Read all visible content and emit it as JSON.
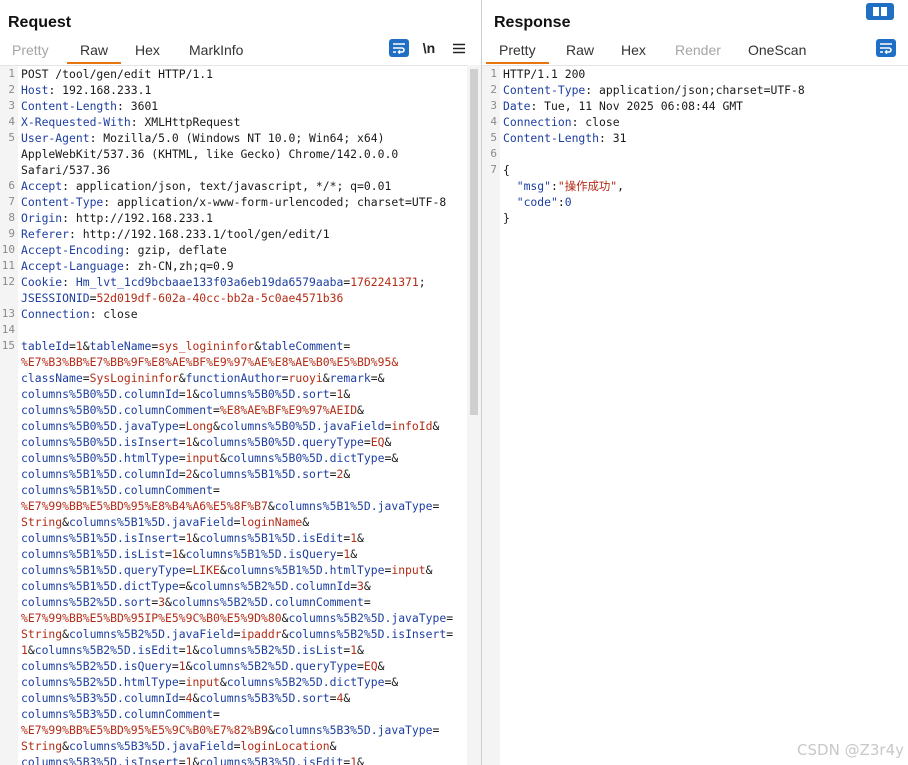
{
  "request": {
    "title": "Request",
    "tabs": [
      "Pretty",
      "Raw",
      "Hex",
      "MarkInfo"
    ],
    "active_tab": "Raw",
    "newline_label": "\\n",
    "lines": [
      {
        "n": "1",
        "type": "first",
        "text": "POST /tool/gen/edit HTTP/1.1"
      },
      {
        "n": "2",
        "type": "header",
        "key": "Host",
        "value": "192.168.233.1"
      },
      {
        "n": "3",
        "type": "header",
        "key": "Content-Length",
        "value": "3601"
      },
      {
        "n": "4",
        "type": "header",
        "key": "X-Requested-With",
        "value": "XMLHttpRequest"
      },
      {
        "n": "5",
        "type": "header",
        "key": "User-Agent",
        "value": "Mozilla/5.0 (Windows NT 10.0; Win64; x64)"
      },
      {
        "n": "",
        "type": "plain",
        "text": "AppleWebKit/537.36 (KHTML, like Gecko) Chrome/142.0.0.0"
      },
      {
        "n": "",
        "type": "plain",
        "text": "Safari/537.36"
      },
      {
        "n": "6",
        "type": "header",
        "key": "Accept",
        "value": "application/json, text/javascript, */*; q=0.01"
      },
      {
        "n": "7",
        "type": "header",
        "key": "Content-Type",
        "value": "application/x-www-form-urlencoded; charset=UTF-8"
      },
      {
        "n": "8",
        "type": "header",
        "key": "Origin",
        "value": "http://192.168.233.1"
      },
      {
        "n": "9",
        "type": "header",
        "key": "Referer",
        "value": "http://192.168.233.1/tool/gen/edit/1"
      },
      {
        "n": "10",
        "type": "header",
        "key": "Accept-Encoding",
        "value": "gzip, deflate"
      },
      {
        "n": "11",
        "type": "header",
        "key": "Accept-Language",
        "value": "zh-CN,zh;q=0.9"
      },
      {
        "n": "12",
        "type": "cookie",
        "key": "Cookie",
        "k1": "Hm_lvt_1cd9bcbaae133f03a6eb19da6579aaba",
        "v1": "1762241371"
      },
      {
        "n": "",
        "type": "cookie2",
        "k2": "JSESSIONID",
        "v2": "52d019df-602a-40cc-bb2a-5c0ae4571b36"
      },
      {
        "n": "13",
        "type": "header",
        "key": "Connection",
        "value": "close"
      },
      {
        "n": "14",
        "type": "plain",
        "text": ""
      },
      {
        "n": "15",
        "type": "body",
        "text": "tableId=1&tableName=sys_logininfor&tableComment="
      },
      {
        "n": "",
        "type": "body",
        "text": "%E7%B3%BB%E7%BB%9F%E8%AE%BF%E9%97%AE%E8%AE%B0%E5%BD%95&"
      },
      {
        "n": "",
        "type": "body",
        "text": "className=SysLogininfor&functionAuthor=ruoyi&remark=&"
      },
      {
        "n": "",
        "type": "body",
        "text": "columns%5B0%5D.columnId=1&columns%5B0%5D.sort=1&"
      },
      {
        "n": "",
        "type": "body",
        "text": "columns%5B0%5D.columnComment=%E8%AE%BF%E9%97%AEID&"
      },
      {
        "n": "",
        "type": "body",
        "text": "columns%5B0%5D.javaType=Long&columns%5B0%5D.javaField=infoId&"
      },
      {
        "n": "",
        "type": "body",
        "text": "columns%5B0%5D.isInsert=1&columns%5B0%5D.queryType=EQ&"
      },
      {
        "n": "",
        "type": "body",
        "text": "columns%5B0%5D.htmlType=input&columns%5B0%5D.dictType=&"
      },
      {
        "n": "",
        "type": "body",
        "text": "columns%5B1%5D.columnId=2&columns%5B1%5D.sort=2&"
      },
      {
        "n": "",
        "type": "body",
        "text": "columns%5B1%5D.columnComment="
      },
      {
        "n": "",
        "type": "body",
        "text": "%E7%99%BB%E5%BD%95%E8%B4%A6%E5%8F%B7&columns%5B1%5D.javaType="
      },
      {
        "n": "",
        "type": "body",
        "text": "String&columns%5B1%5D.javaField=loginName&"
      },
      {
        "n": "",
        "type": "body",
        "text": "columns%5B1%5D.isInsert=1&columns%5B1%5D.isEdit=1&"
      },
      {
        "n": "",
        "type": "body",
        "text": "columns%5B1%5D.isList=1&columns%5B1%5D.isQuery=1&"
      },
      {
        "n": "",
        "type": "body",
        "text": "columns%5B1%5D.queryType=LIKE&columns%5B1%5D.htmlType=input&"
      },
      {
        "n": "",
        "type": "body",
        "text": "columns%5B1%5D.dictType=&columns%5B2%5D.columnId=3&"
      },
      {
        "n": "",
        "type": "body",
        "text": "columns%5B2%5D.sort=3&columns%5B2%5D.columnComment="
      },
      {
        "n": "",
        "type": "body",
        "text": "%E7%99%BB%E5%BD%95IP%E5%9C%B0%E5%9D%80&columns%5B2%5D.javaType="
      },
      {
        "n": "",
        "type": "body",
        "text": "String&columns%5B2%5D.javaField=ipaddr&columns%5B2%5D.isInsert="
      },
      {
        "n": "",
        "type": "body",
        "text": "1&columns%5B2%5D.isEdit=1&columns%5B2%5D.isList=1&"
      },
      {
        "n": "",
        "type": "body",
        "text": "columns%5B2%5D.isQuery=1&columns%5B2%5D.queryType=EQ&"
      },
      {
        "n": "",
        "type": "body",
        "text": "columns%5B2%5D.htmlType=input&columns%5B2%5D.dictType=&"
      },
      {
        "n": "",
        "type": "body",
        "text": "columns%5B3%5D.columnId=4&columns%5B3%5D.sort=4&"
      },
      {
        "n": "",
        "type": "body",
        "text": "columns%5B3%5D.columnComment="
      },
      {
        "n": "",
        "type": "body",
        "text": "%E7%99%BB%E5%BD%95%E5%9C%B0%E7%82%B9&columns%5B3%5D.javaType="
      },
      {
        "n": "",
        "type": "body",
        "text": "String&columns%5B3%5D.javaField=loginLocation&"
      },
      {
        "n": "",
        "type": "body",
        "text": "columns%5B3%5D.isInsert=1&columns%5B3%5D.isEdit=1&"
      }
    ]
  },
  "response": {
    "title": "Response",
    "tabs": [
      "Pretty",
      "Raw",
      "Hex",
      "Render",
      "OneScan"
    ],
    "active_tab": "Pretty",
    "disabled_tabs": [
      "Render"
    ],
    "lines": [
      {
        "n": "1",
        "type": "first",
        "text": "HTTP/1.1 200"
      },
      {
        "n": "2",
        "type": "header",
        "key": "Content-Type",
        "value": "application/json;charset=UTF-8"
      },
      {
        "n": "3",
        "type": "header",
        "key": "Date",
        "value": "Tue, 11 Nov 2025 06:08:44 GMT"
      },
      {
        "n": "4",
        "type": "header",
        "key": "Connection",
        "value": "close"
      },
      {
        "n": "5",
        "type": "header",
        "key": "Content-Length",
        "value": "31"
      },
      {
        "n": "6",
        "type": "plain",
        "text": ""
      },
      {
        "n": "7",
        "type": "plain",
        "text": "{"
      },
      {
        "n": "",
        "type": "json",
        "key": "\"msg\"",
        "value": "\"操作成功\"",
        "trail": ","
      },
      {
        "n": "",
        "type": "json",
        "key": "\"code\"",
        "value": "0",
        "trail": ""
      },
      {
        "n": "",
        "type": "plain",
        "text": "}"
      }
    ]
  },
  "watermark": "CSDN @Z3r4y",
  "colors": {
    "accent": "#e8760f",
    "blue": "#1f6fc5",
    "key": "#1e3fa0",
    "value": "#b32b15"
  }
}
